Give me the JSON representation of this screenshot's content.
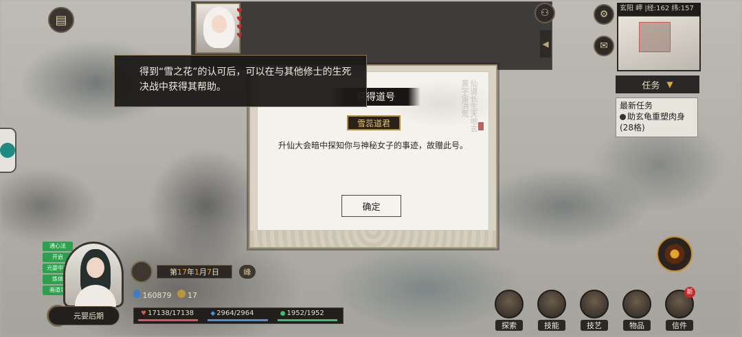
{
  "tooltip": {
    "text": "得到“雪之花”的认可后，可以在与其他修士的生死决战中获得其帮助。"
  },
  "dialog": {
    "title": "获得道号",
    "badge": "雪蕊道君",
    "description": "升仙大会暗中探知你与神秘女子的事迹，故赠此号。",
    "confirm_label": "确定"
  },
  "minimap": {
    "header": "玄阳 岬 |经:162 纬:157"
  },
  "tasks": {
    "button_label": "任务",
    "card_title": "最新任务",
    "card_item": "助玄龟重塑肉身(28格)"
  },
  "player": {
    "tags": [
      "通心法",
      "开启",
      "元婴中期",
      "炼体",
      "画道功"
    ],
    "date_prefix": "第",
    "date_year": "17",
    "date_mid1": "年",
    "date_month": "1",
    "date_mid2": "月",
    "date_day": "7",
    "date_suffix": "日",
    "moon": "峰",
    "spirit_stones": "160879",
    "coins": "17",
    "name_label": "元婴后期",
    "hp": "17138/17138",
    "mp": "2964/2964",
    "sp": "1952/1952"
  },
  "actions": [
    {
      "label": "探索"
    },
    {
      "label": "技能"
    },
    {
      "label": "技艺"
    },
    {
      "label": "物品"
    },
    {
      "label": "信件",
      "badge": "新"
    }
  ],
  "colors": {
    "hp": "#e25555",
    "mp": "#4c8fe0",
    "sp": "#3fc06a",
    "accent_gold": "#d9a73a"
  }
}
